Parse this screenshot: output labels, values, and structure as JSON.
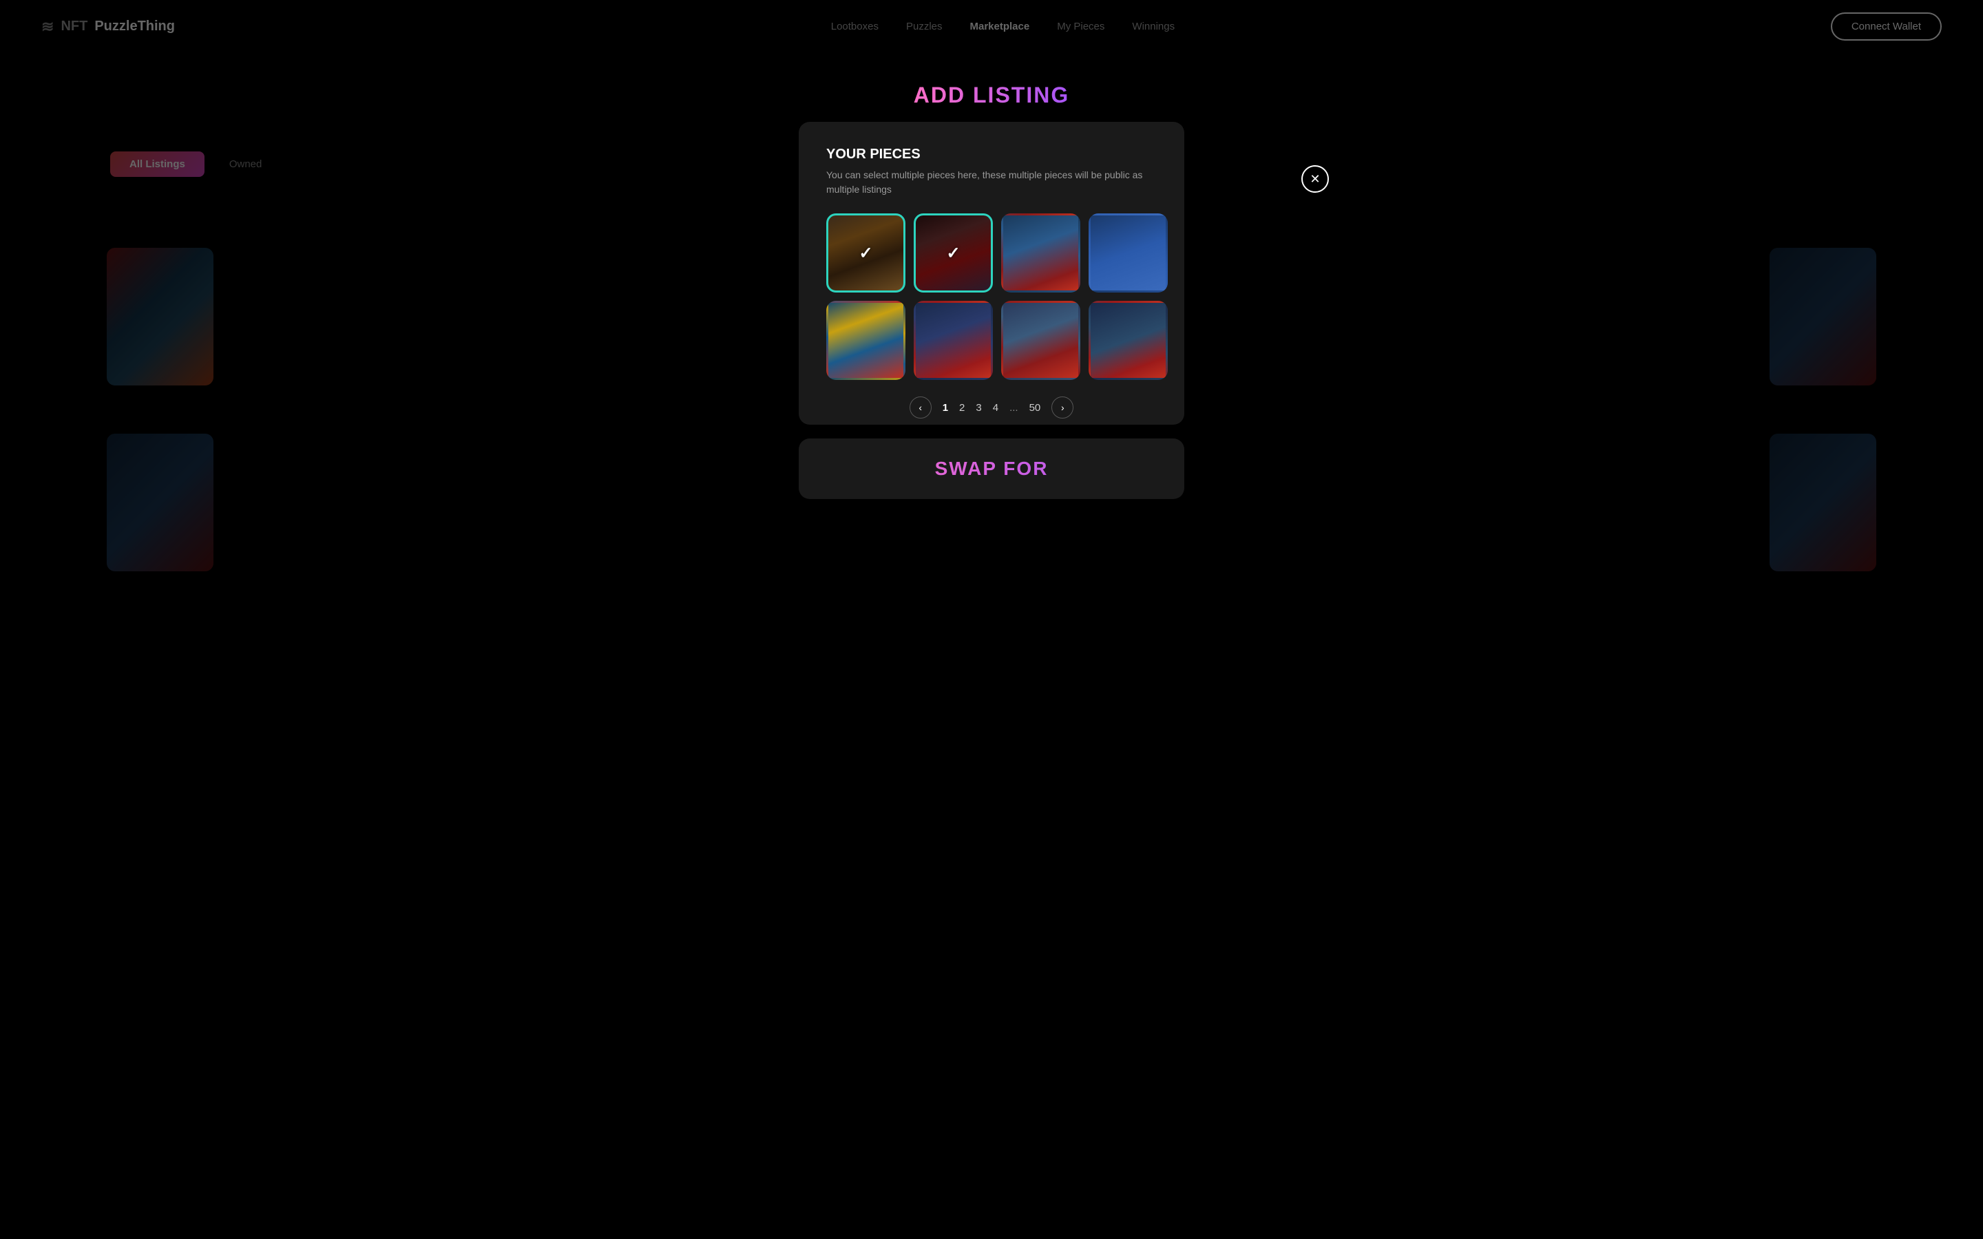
{
  "app": {
    "title": "NFTPuzzleThing"
  },
  "nav": {
    "logo_nft": "NFT",
    "logo_puzzle": "PuzzleThing",
    "links": [
      {
        "label": "Lootboxes",
        "active": false
      },
      {
        "label": "Puzzles",
        "active": false
      },
      {
        "label": "Marketplace",
        "active": true
      },
      {
        "label": "My Pieces",
        "active": false
      },
      {
        "label": "Winnings",
        "active": false
      }
    ],
    "connect_wallet": "Connect Wallet"
  },
  "tabs": [
    {
      "label": "All Listings",
      "active": true
    },
    {
      "label": "Owned",
      "active": false
    }
  ],
  "modal": {
    "title": "ADD LISTING",
    "close_icon": "✕",
    "your_pieces_title": "YOUR PIECES",
    "your_pieces_desc": "You can select multiple pieces here, these multiple pieces will be public as multiple listings",
    "pieces": [
      {
        "id": 1,
        "selected": true,
        "art": "art-brown-tree"
      },
      {
        "id": 2,
        "selected": true,
        "art": "art-dark-red"
      },
      {
        "id": 3,
        "selected": false,
        "art": "art-blue-red"
      },
      {
        "id": 4,
        "selected": false,
        "art": "art-blue-cloud"
      },
      {
        "id": 5,
        "selected": false,
        "art": "art-blue-yellow"
      },
      {
        "id": 6,
        "selected": false,
        "art": "art-blue-red2"
      },
      {
        "id": 7,
        "selected": false,
        "art": "art-mixed"
      },
      {
        "id": 8,
        "selected": false,
        "art": "art-dark-blue"
      }
    ],
    "pagination": {
      "prev_icon": "‹",
      "next_icon": "›",
      "pages": [
        "1",
        "2",
        "3",
        "4",
        "...",
        "50"
      ],
      "active_page": "1"
    },
    "swap_title": "SWAP FOR"
  }
}
